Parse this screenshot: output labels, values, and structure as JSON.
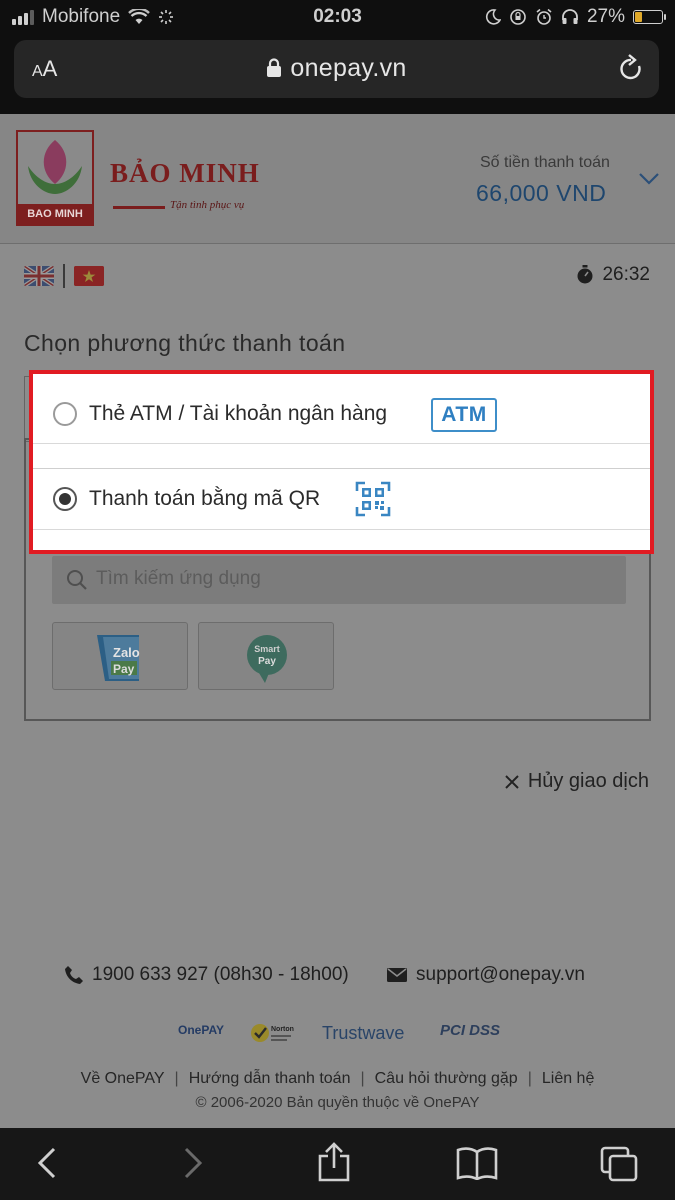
{
  "status_bar": {
    "carrier": "Mobifone",
    "time": "02:03",
    "battery": "27%",
    "battery_level": 0.27
  },
  "browser": {
    "text_size_label_small": "A",
    "text_size_label_large": "A",
    "url": "onepay.vn"
  },
  "merchant": {
    "logo_label": "BAO MINH",
    "brand_name": "BẢO MINH",
    "tagline": "Tận tình phục vụ",
    "amount_label": "Số tiền thanh toán",
    "amount": "66,000 VND"
  },
  "timer": "26:32",
  "section_title": "Chọn phương thức thanh toán",
  "options": {
    "atm_label": "Thẻ ATM / Tài khoản ngân hàng",
    "atm_badge": "ATM",
    "qr_label": "Thanh toán bằng mã QR"
  },
  "qr_panel": {
    "search_placeholder": "Tìm kiếm ứng dụng",
    "apps": [
      {
        "line1": "Zalo",
        "line2": "Pay"
      },
      {
        "line1": "Smart",
        "line2": "Pay"
      }
    ]
  },
  "cancel_label": "Hủy giao dịch",
  "contact": {
    "phone": "1900 633 927 (08h30 - 18h00)",
    "email": "support@onepay.vn"
  },
  "trust": {
    "onepay": "OnePAY",
    "norton": "Norton",
    "trustwave": "Trustwave",
    "pci": "PCI DSS"
  },
  "footer": {
    "links": [
      "Về OnePAY",
      "Hướng dẫn thanh toán",
      "Câu hỏi thường gặp",
      "Liên hệ"
    ],
    "copyright": "© 2006-2020 Bản quyền thuộc về OnePAY"
  }
}
